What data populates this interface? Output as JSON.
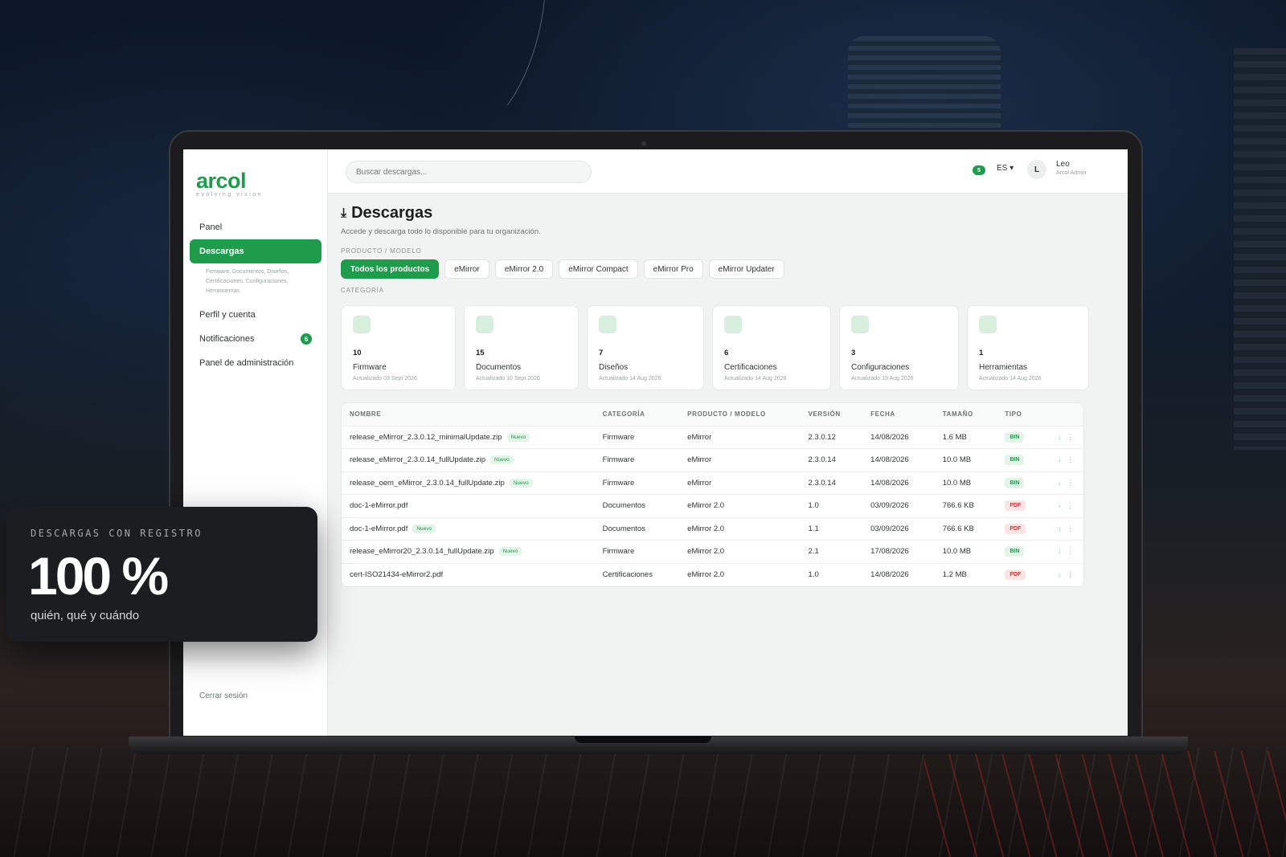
{
  "brand": {
    "name": "arcol",
    "tagline": "evolving vision",
    "accent": "#1f9b4c"
  },
  "sidebar": {
    "items": [
      {
        "label": "Panel"
      },
      {
        "label": "Descargas",
        "sub": "Firmware, Documentos, Diseños, Certificaciones, Configuraciones, Herramientas"
      },
      {
        "label": "Perfil y cuenta"
      },
      {
        "label": "Notificaciones",
        "badge": "6"
      },
      {
        "label": "Panel de administración"
      }
    ],
    "logout": "Cerrar sesión"
  },
  "topbar": {
    "search_placeholder": "Buscar descargas...",
    "notif_count": "5",
    "language": "ES ▾",
    "avatar_initial": "L",
    "user_name": "Leo",
    "user_role": "Arcol Admin"
  },
  "page": {
    "icon": "⤓",
    "title": "Descargas",
    "subtitle": "Accede y descarga todo lo disponible para tu organización.",
    "product_label": "PRODUCTO / MODELO",
    "category_label": "CATEGORÍA"
  },
  "product_filters": [
    "Todos los productos",
    "eMirror",
    "eMirror 2.0",
    "eMirror Compact",
    "eMirror Pro",
    "eMirror Updater"
  ],
  "categories": [
    {
      "count": "10",
      "label": "Firmware",
      "updated": "Actualizado 03 Sept 2026"
    },
    {
      "count": "15",
      "label": "Documentos",
      "updated": "Actualizado 10 Sept 2026"
    },
    {
      "count": "7",
      "label": "Diseños",
      "updated": "Actualizado 14 Aug 2026"
    },
    {
      "count": "6",
      "label": "Certificaciones",
      "updated": "Actualizado 14 Aug 2026"
    },
    {
      "count": "3",
      "label": "Configuraciones",
      "updated": "Actualizado 19 Aug 2026"
    },
    {
      "count": "1",
      "label": "Herramientas",
      "updated": "Actualizado 14 Aug 2026"
    }
  ],
  "table": {
    "headers": [
      "NOMBRE",
      "CATEGORÍA",
      "PRODUCTO / MODELO",
      "VERSIÓN",
      "FECHA",
      "TAMAÑO",
      "TIPO"
    ],
    "new_label": "Nuevo",
    "actions_label": "↓ ⋮",
    "rows": [
      {
        "name": "release_eMirror_2.3.0.12_minimalUpdate.zip",
        "is_new": true,
        "category": "Firmware",
        "product": "eMirror",
        "version": "2.3.0.12",
        "date": "14/08/2026",
        "size": "1.6 MB",
        "type": "BIN"
      },
      {
        "name": "release_eMirror_2.3.0.14_fullUpdate.zip",
        "is_new": true,
        "category": "Firmware",
        "product": "eMirror",
        "version": "2.3.0.14",
        "date": "14/08/2026",
        "size": "10.0 MB",
        "type": "BIN"
      },
      {
        "name": "release_oem_eMirror_2.3.0.14_fullUpdate.zip",
        "is_new": true,
        "category": "Firmware",
        "product": "eMirror",
        "version": "2.3.0.14",
        "date": "14/08/2026",
        "size": "10.0 MB",
        "type": "BIN"
      },
      {
        "name": "doc-1-eMirror.pdf",
        "is_new": false,
        "category": "Documentos",
        "product": "eMirror 2.0",
        "version": "1.0",
        "date": "03/09/2026",
        "size": "766.6 KB",
        "type": "PDF"
      },
      {
        "name": "doc-1-eMirror.pdf",
        "is_new": true,
        "category": "Documentos",
        "product": "eMirror 2.0",
        "version": "1.1",
        "date": "03/09/2026",
        "size": "766.6 KB",
        "type": "PDF"
      },
      {
        "name": "release_eMirror20_2.3.0.14_fullUpdate.zip",
        "is_new": true,
        "category": "Firmware",
        "product": "eMirror 2.0",
        "version": "2.1",
        "date": "17/08/2026",
        "size": "10.0 MB",
        "type": "BIN"
      },
      {
        "name": "cert-ISO21434-eMirror2.pdf",
        "is_new": false,
        "category": "Certificaciones",
        "product": "eMirror 2.0",
        "version": "1.0",
        "date": "14/08/2026",
        "size": "1.2 MB",
        "type": "PDF"
      }
    ]
  },
  "overlay": {
    "label": "DESCARGAS CON REGISTRO",
    "value": "100 %",
    "caption": "quién, qué y cuándo"
  }
}
